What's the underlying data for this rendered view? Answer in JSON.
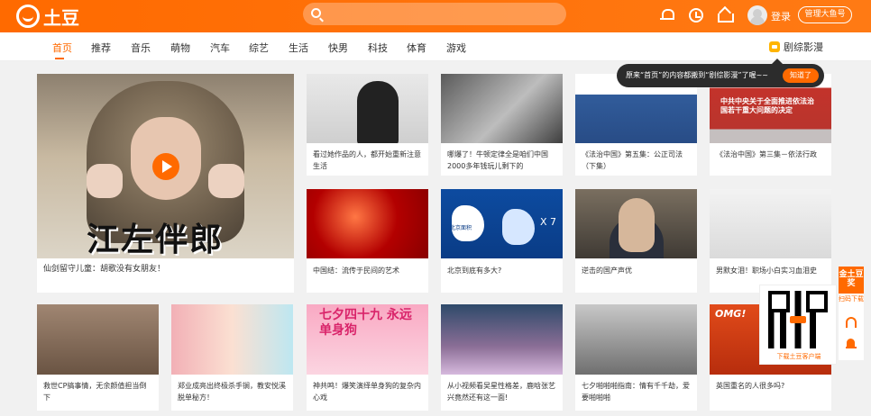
{
  "header": {
    "logo_text": "土豆",
    "search_placeholder": "",
    "login": "登录",
    "manage": "管理大鱼号"
  },
  "nav": {
    "items": [
      "首页",
      "推荐",
      "音乐",
      "萌物",
      "汽车",
      "综艺",
      "生活",
      "快男",
      "科技",
      "体育",
      "游戏"
    ],
    "active": "首页",
    "drama_link": "剧综影漫"
  },
  "tooltip": {
    "text": "原来“首页”的内容都搬到“剧综影漫”了喔~~",
    "button": "知道了"
  },
  "hero": {
    "overlay_text": "江左伴郎",
    "caption": "仙剑留守儿童：胡歌没有女朋友！"
  },
  "row1": [
    "看过她作品的人，都开始重新注意生活",
    "哪爆了！牛顿定律全是咱们中国2000多年钱玩儿剩下的",
    "《法治中国》第五集：公正司法（下集）",
    "《法治中国》第三集－依法行政"
  ],
  "row1_overlays": {
    "banner": "中共中央关于全面推进依法治国若干重大问题的决定"
  },
  "row2": [
    "中国结：流传于民间的艺术",
    "北京到底有多大?",
    "逆击的国产声优",
    "男默女泪！职场小白实习血泪史"
  ],
  "row2_overlays": {
    "map_label": "北京面积",
    "multiplier": "X 7"
  },
  "row3": [
    "救世CP搞事情，无余颜值担当倒下",
    "郑业成亮出终极杀手锏，教安悦溪脱单秘方！",
    "神共鸣！爆笑演绎单身狗的复杂内心戏",
    "从小视频看吴星性格差，鹿晗张艺兴竟然还有这一面!",
    "七夕啪啪啪指南：情有千千劫，爱要啪啪啪",
    "英国重名的人很多吗?"
  ],
  "row3_overlays": {
    "qixi_title": "七夕四十九 永远单身狗",
    "omg": "OMG!"
  },
  "sidebar": {
    "qr_caption": "下载土豆客户端",
    "tag": "金土豆奖",
    "download": "扫码下载"
  }
}
